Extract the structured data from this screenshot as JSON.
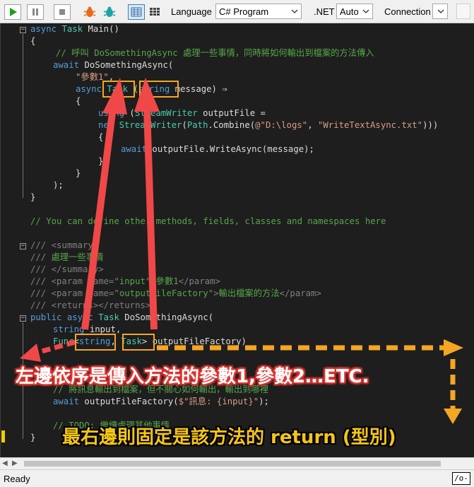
{
  "toolbar": {
    "language_label": "Language",
    "language_value": "C# Program",
    "dotnet_label": ".NET",
    "dotnet_value": "Auto",
    "connection_label": "Connection"
  },
  "code": {
    "l1_kw": "async",
    "l1_ty": "Task",
    "l1_fn": "Main()",
    "l2": "{",
    "l3_cm": "// 呼叫 DoSomethingAsync 處理一些事情，同時將如何輸出到檔案的方法傳入",
    "l4_kw": "await",
    "l4_tx": "DoSomethingAsync(",
    "l5_st": "\"參數1\"",
    "l5_tx": ",",
    "l6_kw": "async",
    "l6_ty": "Task",
    "l6_tx1": " (",
    "l6_kw2": "string",
    "l6_tx2": " message) ⇒",
    "l7": "{",
    "l8_kw": "using",
    "l8_tx1": " (",
    "l8_ty": "StreamWriter",
    "l8_tx2": " outputFile =",
    "l9_kw": "new",
    "l9_ty": "StreamWriter",
    "l9_tx1": "(",
    "l9_ty2": "Path",
    "l9_tx2": ".Combine(",
    "l9_st1": "@\"D:\\logs\"",
    "l9_tx3": ", ",
    "l9_st2": "\"WriteTextAsync.txt\"",
    "l9_tx4": ")))",
    "l10": "{",
    "l11_kw": "await",
    "l11_tx": " outputFile.WriteAsync(message);",
    "l12": "}",
    "l13": "}",
    "l14": ");",
    "l15": "}",
    "l16_cm": "// You can define other methods, fields, classes and namespaces here",
    "l17_xd": "/// <summary>",
    "l18_xd": "/// ",
    "l18_cm": "處理一些事情",
    "l19_xd": "/// </summary>",
    "l20_xd1": "/// <param name=\"",
    "l20_cm1": "input",
    "l20_xd2": "\">",
    "l20_cm2": "參數1",
    "l20_xd3": "</param>",
    "l21_xd1": "/// <param name=\"",
    "l21_cm1": "outputFileFactory",
    "l21_xd2": "\">",
    "l21_cm2": "輸出檔案的方法",
    "l21_xd3": "</param>",
    "l22_xd": "/// <returns></returns>",
    "l23_kw1": "public",
    "l23_kw2": "async",
    "l23_ty": "Task",
    "l23_fn": "DoSomethingAsync(",
    "l24_kw": "string",
    "l24_tx": " input,",
    "l25_ty": "Func",
    "l25_tx1": "<",
    "l25_kw": "string",
    "l25_tx2": ", ",
    "l25_ty2": "Task",
    "l25_tx3": "> outputFileFactory)",
    "l27_cm": "// 將訊息輸出到檔案，但不關心如何輸出，輸出到哪裡",
    "l28_kw": "await",
    "l28_tx1": " outputFileFactory(",
    "l28_st": "$\"訊息: {input}\"",
    "l28_tx2": ");",
    "l29_cm": "// TODO: 繼續處理其他事情",
    "l30": "}"
  },
  "annotations": {
    "caption1": "左邊依序是傳入方法的參數1,參數2…ETC.",
    "caption2": "最右邊則固定是該方法的 return (型別)",
    "arrow_color": "#f04848",
    "dashed_color": "#f5a623"
  },
  "status": {
    "ready": "Ready",
    "indicator": "/o-"
  }
}
